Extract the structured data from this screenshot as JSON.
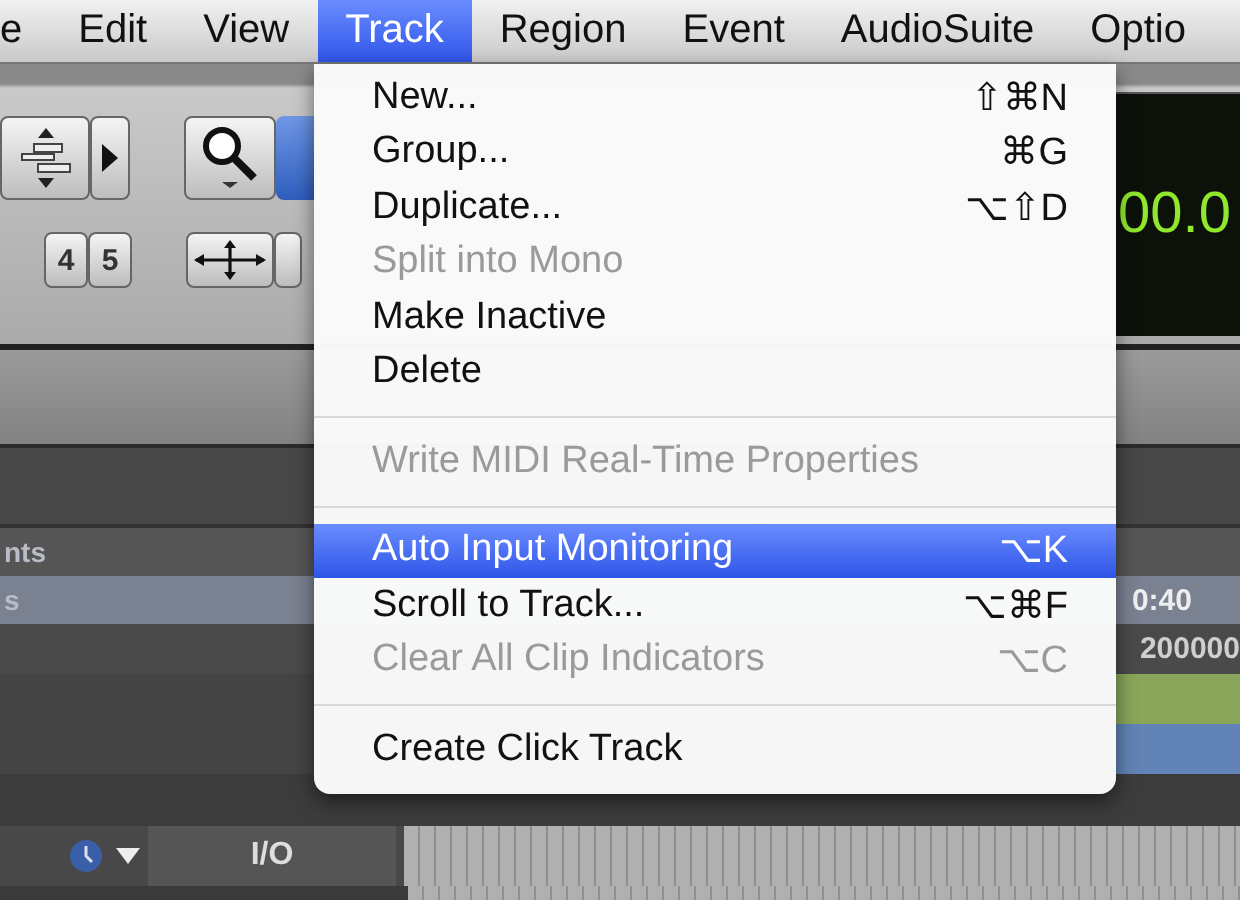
{
  "menu_bar": {
    "items": [
      {
        "label": "e",
        "selected": false
      },
      {
        "label": "Edit",
        "selected": false
      },
      {
        "label": "View",
        "selected": false
      },
      {
        "label": "Track",
        "selected": true
      },
      {
        "label": "Region",
        "selected": false
      },
      {
        "label": "Event",
        "selected": false
      },
      {
        "label": "AudioSuite",
        "selected": false
      },
      {
        "label": "Optio",
        "selected": false
      }
    ]
  },
  "track_menu": {
    "items": [
      {
        "kind": "item",
        "label": "New...",
        "shortcut": "⇧⌘N",
        "disabled": false,
        "selected": false
      },
      {
        "kind": "item",
        "label": "Group...",
        "shortcut": "⌘G",
        "disabled": false,
        "selected": false
      },
      {
        "kind": "item",
        "label": "Duplicate...",
        "shortcut": "⌥⇧D",
        "disabled": false,
        "selected": false
      },
      {
        "kind": "item",
        "label": "Split into Mono",
        "disabled": true,
        "selected": false
      },
      {
        "kind": "item",
        "label": "Make Inactive",
        "disabled": false,
        "selected": false
      },
      {
        "kind": "item",
        "label": "Delete",
        "disabled": false,
        "selected": false
      },
      {
        "kind": "separator"
      },
      {
        "kind": "item",
        "label": "Write MIDI Real-Time Properties",
        "disabled": true,
        "selected": false
      },
      {
        "kind": "separator"
      },
      {
        "kind": "item",
        "label": "Auto Input Monitoring",
        "shortcut": "⌥K",
        "disabled": false,
        "selected": true
      },
      {
        "kind": "item",
        "label": "Scroll to Track...",
        "shortcut": "⌥⌘F",
        "disabled": false,
        "selected": false
      },
      {
        "kind": "item",
        "label": "Clear All Clip Indicators",
        "shortcut": "⌥C",
        "disabled": true,
        "selected": false
      },
      {
        "kind": "separator"
      },
      {
        "kind": "item",
        "label": "Create Click Track",
        "disabled": false,
        "selected": false
      }
    ]
  },
  "toolbar": {
    "number_buttons": [
      "4",
      "5"
    ],
    "counter": "00.0"
  },
  "tracks": {
    "column_1_header": "nts",
    "column_1_row": "s",
    "ruler_time": "0:40",
    "ruler_samples": "200000",
    "io_header": "I/O"
  }
}
